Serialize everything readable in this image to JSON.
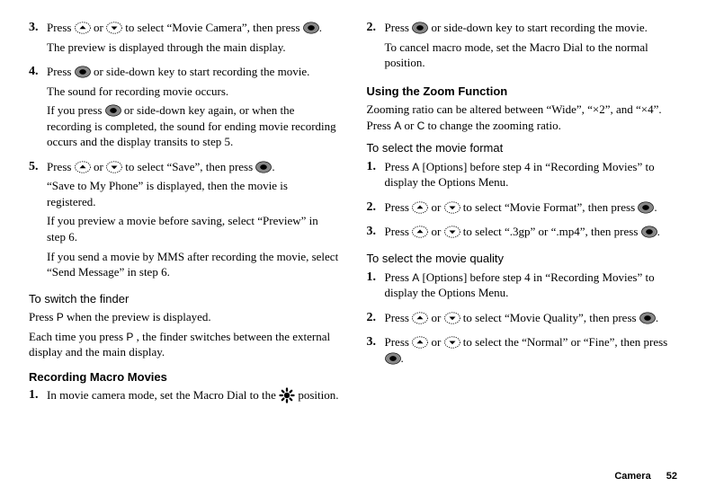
{
  "left": {
    "step3": {
      "num": "3.",
      "p1a": "Press ",
      "p1b": " or ",
      "p1c": " to select “Movie Camera”, then press ",
      "p1d": ".",
      "p2": "The preview is displayed through the main display."
    },
    "step4": {
      "num": "4.",
      "p1a": "Press ",
      "p1b": " or side-down key to start recording the movie.",
      "p2": "The sound for recording movie occurs.",
      "p3a": "If you press ",
      "p3b": " or side-down key again, or when the recording is completed, the sound for ending movie recording occurs and the display transits to step 5."
    },
    "step5": {
      "num": "5.",
      "p1a": "Press ",
      "p1b": " or ",
      "p1c": " to select “Save”, then press ",
      "p1d": ".",
      "p2": "“Save to My Phone” is displayed, then the movie is registered.",
      "p3": "If you preview a movie before saving, select “Preview” in step 6.",
      "p4": "If you send a movie by MMS after recording the movie, select “Send Message” in step 6."
    },
    "switch_h": "To switch the finder",
    "switch_p1a": "Press ",
    "switch_p1b": " when the preview is displayed.",
    "switch_p2a": "Each time you press ",
    "switch_p2b": ", the finder switches between the external display and the main display.",
    "macro_h": "Recording Macro Movies",
    "macro_s1": {
      "num": "1.",
      "p1a": "In movie camera mode, set the Macro Dial to the ",
      "p1b": " position."
    }
  },
  "right": {
    "step2": {
      "num": "2.",
      "p1a": "Press ",
      "p1b": " or side-down key to start recording the movie.",
      "p2": "To cancel macro mode, set the Macro Dial to the normal position."
    },
    "zoom_h": "Using the Zoom Function",
    "zoom_p_a": "Zooming ratio can be altered between “Wide”, “×2”, and “×4”. Press ",
    "zoom_p_b": " or ",
    "zoom_p_c": " to change the zooming ratio.",
    "fmt_h": "To select the movie format",
    "fmt_s1": {
      "num": "1.",
      "p1a": "Press ",
      "p1b": " [Options] before step 4 in “Recording Movies” to display the Options Menu."
    },
    "fmt_s2": {
      "num": "2.",
      "p1a": "Press ",
      "p1b": " or ",
      "p1c": " to select “Movie Format”, then press ",
      "p1d": "."
    },
    "fmt_s3": {
      "num": "3.",
      "p1a": "Press ",
      "p1b": " or ",
      "p1c": " to select “.3gp” or “.mp4”, then press ",
      "p1d": "."
    },
    "qual_h": "To select the movie quality",
    "qual_s1": {
      "num": "1.",
      "p1a": "Press ",
      "p1b": " [Options] before step 4 in “Recording Movies” to display the Options Menu."
    },
    "qual_s2": {
      "num": "2.",
      "p1a": "Press ",
      "p1b": " or ",
      "p1c": " to select “Movie Quality”, then press ",
      "p1d": "."
    },
    "qual_s3": {
      "num": "3.",
      "p1a": "Press ",
      "p1b": " or ",
      "p1c": " to select the “Normal” or “Fine”, then press ",
      "p1d": "."
    }
  },
  "keys": {
    "P": "P",
    "A": "A",
    "C": "C"
  },
  "footer": {
    "section": "Camera",
    "page": "52"
  }
}
